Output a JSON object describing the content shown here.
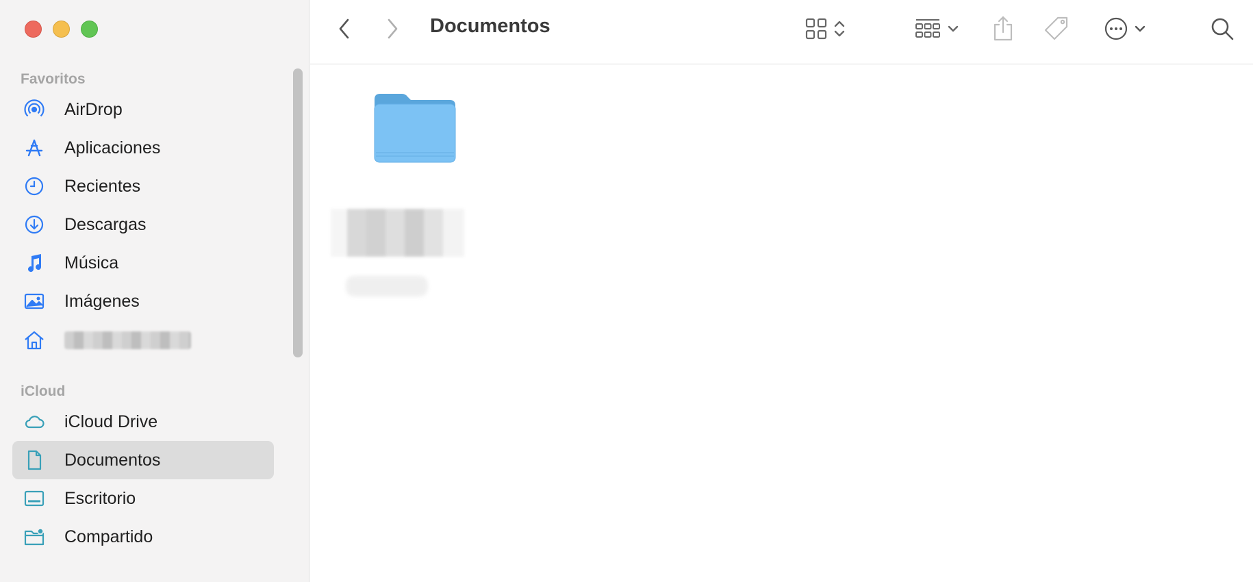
{
  "window": {
    "title": "Documentos"
  },
  "sidebar": {
    "sections": [
      {
        "label": "Favoritos"
      },
      {
        "label": "iCloud"
      }
    ],
    "favorites": [
      {
        "label": "AirDrop",
        "icon": "airdrop-icon"
      },
      {
        "label": "Aplicaciones",
        "icon": "applications-icon"
      },
      {
        "label": "Recientes",
        "icon": "clock-icon"
      },
      {
        "label": "Descargas",
        "icon": "download-icon"
      },
      {
        "label": "Música",
        "icon": "music-note-icon"
      },
      {
        "label": "Imágenes",
        "icon": "photo-icon"
      },
      {
        "label": "",
        "icon": "home-icon"
      }
    ],
    "icloud": [
      {
        "label": "iCloud Drive",
        "icon": "cloud-icon"
      },
      {
        "label": "Documentos",
        "icon": "document-icon",
        "selected": true
      },
      {
        "label": "Escritorio",
        "icon": "desktop-icon"
      },
      {
        "label": "Compartido",
        "icon": "shared-folder-icon"
      }
    ]
  },
  "toolbar": {
    "back_icon": "chevron-left-icon",
    "forward_icon": "chevron-right-icon",
    "view_icon": "grid-view-icon",
    "group_icon": "group-icon",
    "share_icon": "share-icon",
    "tag_icon": "tag-icon",
    "more_icon": "ellipsis-circle-icon",
    "search_icon": "search-icon"
  },
  "content": {
    "items": [
      {
        "type": "folder",
        "name": "",
        "icon": "folder-icon"
      }
    ]
  },
  "colors": {
    "accent": "#2f7bf5",
    "icloud_icon": "#39a0b8",
    "sidebar_bg": "#f4f3f3",
    "selected_bg": "#dcdcdc",
    "folder_blue": "#7cc2f4"
  }
}
